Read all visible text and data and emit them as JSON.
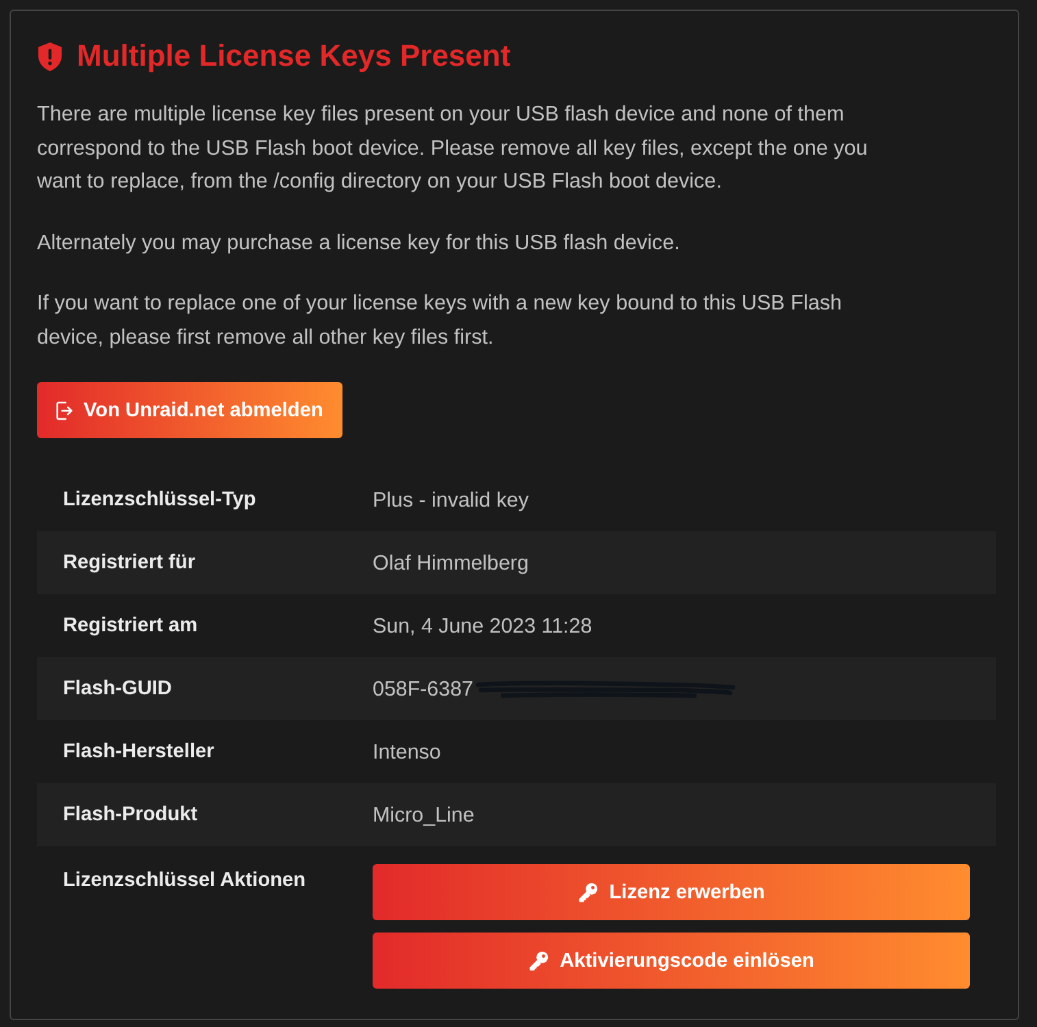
{
  "alert": {
    "title": "Multiple License Keys Present",
    "paragraphs": [
      "There are multiple license key files present on your USB flash device and none of them correspond to the USB Flash boot device. Please remove all key files, except the one you want to replace, from the /config directory on your USB Flash boot device.",
      "Alternately you may purchase a license key for this USB flash device.",
      "If you want to replace one of your license keys with a new key bound to this USB Flash device, please first remove all other key files first."
    ]
  },
  "sign_out_button": {
    "label": "Von Unraid.net abmelden"
  },
  "details": {
    "rows": [
      {
        "label": "Lizenzschlüssel-Typ",
        "value": "Plus - invalid key",
        "redacted": false
      },
      {
        "label": "Registriert für",
        "value": "Olaf Himmelberg",
        "redacted": false
      },
      {
        "label": "Registriert am",
        "value": "Sun, 4 June 2023 11:28",
        "redacted": false
      },
      {
        "label": "Flash-GUID",
        "value": "058F-6387",
        "redacted": true
      },
      {
        "label": "Flash-Hersteller",
        "value": "Intenso",
        "redacted": false
      },
      {
        "label": "Flash-Produkt",
        "value": "Micro_Line",
        "redacted": false
      }
    ],
    "actions": {
      "label": "Lizenzschlüssel Aktionen",
      "buttons": [
        "Lizenz erwerben",
        "Aktivierungscode einlösen"
      ]
    }
  }
}
